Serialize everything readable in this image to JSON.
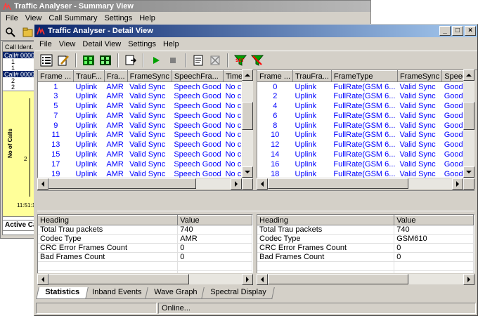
{
  "summary": {
    "title": "Traffic Analyser - Summary View",
    "menu": [
      "File",
      "View",
      "Call Summary",
      "Settings",
      "Help"
    ],
    "tree_header": "Call Ident...",
    "tree": [
      {
        "label": "Call# 0000",
        "level": 0,
        "selected": true
      },
      {
        "label": "1",
        "level": 1
      },
      {
        "label": "1",
        "level": 1
      },
      {
        "label": "Call# 0000",
        "level": 0,
        "selected": true
      },
      {
        "label": "2",
        "level": 1
      },
      {
        "label": "2",
        "level": 1
      }
    ],
    "graph": {
      "ylabel": "No of Calls",
      "ytick": "2",
      "time": "11:51:1"
    },
    "tab": "Active Ca"
  },
  "detail": {
    "title": "Traffic Analyser - Detail View",
    "menu": [
      "File",
      "View",
      "Detail View",
      "Settings",
      "Help"
    ],
    "uplink_grid": {
      "columns": [
        "Frame ...",
        "TrauF...",
        "Fra...",
        "FrameSync",
        "SpeechFra...",
        "TimeAlign"
      ],
      "rows": [
        [
          "1",
          "Uplink",
          "AMR",
          "Valid Sync",
          "Speech Good",
          "No chang"
        ],
        [
          "3",
          "Uplink",
          "AMR",
          "Valid Sync",
          "Speech Good",
          "No chang"
        ],
        [
          "5",
          "Uplink",
          "AMR",
          "Valid Sync",
          "Speech Good",
          "No chang"
        ],
        [
          "7",
          "Uplink",
          "AMR",
          "Valid Sync",
          "Speech Good",
          "No chang"
        ],
        [
          "9",
          "Uplink",
          "AMR",
          "Valid Sync",
          "Speech Good",
          "No chang"
        ],
        [
          "11",
          "Uplink",
          "AMR",
          "Valid Sync",
          "Speech Good",
          "No chang"
        ],
        [
          "13",
          "Uplink",
          "AMR",
          "Valid Sync",
          "Speech Good",
          "No chang"
        ],
        [
          "15",
          "Uplink",
          "AMR",
          "Valid Sync",
          "Speech Good",
          "No chang"
        ],
        [
          "17",
          "Uplink",
          "AMR",
          "Valid Sync",
          "Speech Good",
          "No chang"
        ],
        [
          "19",
          "Uplink",
          "AMR",
          "Valid Sync",
          "Speech Good",
          "No chang"
        ]
      ]
    },
    "downlink_grid": {
      "columns": [
        "Frame ...",
        "TrauFra...",
        "FrameType",
        "FrameSync",
        "Speec..."
      ],
      "rows": [
        [
          "0",
          "Uplink",
          "FullRate(GSM 6...",
          "Valid Sync",
          "Good S..."
        ],
        [
          "2",
          "Uplink",
          "FullRate(GSM 6...",
          "Valid Sync",
          "Good S..."
        ],
        [
          "4",
          "Uplink",
          "FullRate(GSM 6...",
          "Valid Sync",
          "Good S..."
        ],
        [
          "6",
          "Uplink",
          "FullRate(GSM 6...",
          "Valid Sync",
          "Good S..."
        ],
        [
          "8",
          "Uplink",
          "FullRate(GSM 6...",
          "Valid Sync",
          "Good S..."
        ],
        [
          "10",
          "Uplink",
          "FullRate(GSM 6...",
          "Valid Sync",
          "Good S..."
        ],
        [
          "12",
          "Uplink",
          "FullRate(GSM 6...",
          "Valid Sync",
          "Good S..."
        ],
        [
          "14",
          "Uplink",
          "FullRate(GSM 6...",
          "Valid Sync",
          "Good S..."
        ],
        [
          "16",
          "Uplink",
          "FullRate(GSM 6...",
          "Valid Sync",
          "Good S..."
        ],
        [
          "18",
          "Uplink",
          "FullRate(GSM 6...",
          "Valid Sync",
          "Good S..."
        ]
      ]
    },
    "stats_left": {
      "columns": [
        "Heading",
        "Value"
      ],
      "rows": [
        [
          "Total Trau packets",
          "740"
        ],
        [
          "Codec Type",
          "AMR"
        ],
        [
          "CRC Error Frames Count",
          "0"
        ],
        [
          "Bad Frames Count",
          "0"
        ]
      ]
    },
    "stats_right": {
      "columns": [
        "Heading",
        "Value"
      ],
      "rows": [
        [
          "Total Trau packets",
          "740"
        ],
        [
          "Codec Type",
          "GSM610"
        ],
        [
          "CRC Error Frames Count",
          "0"
        ],
        [
          "Bad Frames Count",
          "0"
        ]
      ]
    },
    "tabs": [
      "Statistics",
      "Inband Events",
      "Wave Graph",
      "Spectral Display"
    ],
    "active_tab": 0,
    "status": "Online..."
  },
  "colors": {
    "title_active": "#0a246a",
    "title_inactive": "#808080",
    "grid_text": "#0000ff",
    "face": "#d4d0c8"
  }
}
